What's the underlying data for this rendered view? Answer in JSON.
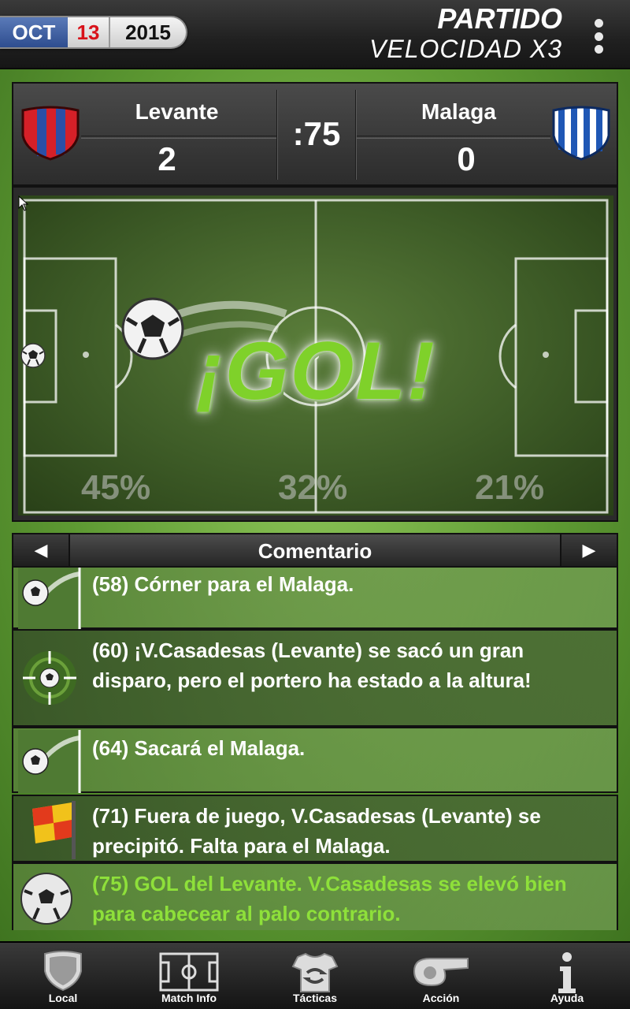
{
  "header": {
    "date": {
      "month": "OCT",
      "day": "13",
      "year": "2015"
    },
    "title": "PARTIDO",
    "subtitle": "VELOCIDAD X3",
    "menu_icon": "more-vertical-icon"
  },
  "scoreboard": {
    "home": {
      "name": "Levante",
      "score": "2",
      "crest_colors": [
        "#d62028",
        "#2b4fa6"
      ]
    },
    "away": {
      "name": "Malaga",
      "score": "0",
      "crest_colors": [
        "#1f57b5",
        "#ffffff"
      ]
    },
    "minute": ":75"
  },
  "pitch": {
    "goal_banner": "¡GOL!",
    "possession": {
      "left": "45%",
      "middle": "32%",
      "right": "21%"
    }
  },
  "commentary": {
    "title": "Comentario",
    "prev_icon": "arrow-left-icon",
    "next_icon": "arrow-right-icon",
    "items": [
      {
        "text": "(58) Córner para el Malaga.",
        "icon": "corner-icon"
      },
      {
        "text": "(60) ¡V.Casadesas (Levante) se sacó un gran disparo, pero el portero ha estado a la altura!",
        "icon": "shot-target-icon"
      },
      {
        "text": "(64) Sacará el Malaga.",
        "icon": "corner-icon"
      },
      {
        "text": "(71) Fuera de juego, V.Casadesas (Levante) se precipitó. Falta para el Malaga.",
        "icon": "offside-flag-icon"
      },
      {
        "text": "(75) GOL del Levante. V.Casadesas se elevó bien para cabecear al palo contrario.",
        "icon": "goal-ball-icon"
      }
    ]
  },
  "nav": [
    {
      "label": "Local",
      "icon": "shield-icon"
    },
    {
      "label": "Match Info",
      "icon": "pitch-icon"
    },
    {
      "label": "Tácticas",
      "icon": "tactics-shirt-icon"
    },
    {
      "label": "Acción",
      "icon": "whistle-icon"
    },
    {
      "label": "Ayuda",
      "icon": "info-icon"
    }
  ],
  "colors": {
    "goal_green": "#7fd12a",
    "highlight_text": "#8ee03a",
    "date_red": "#d8121a"
  }
}
